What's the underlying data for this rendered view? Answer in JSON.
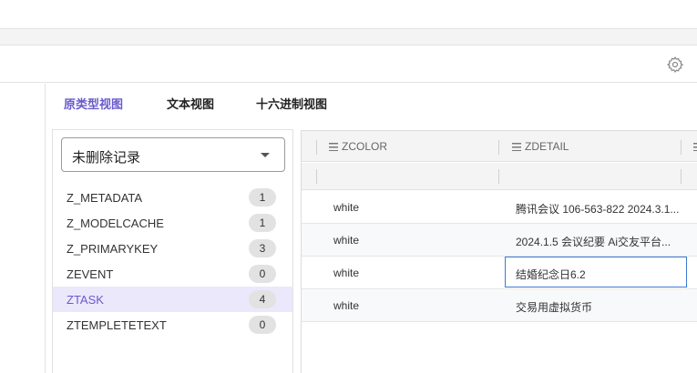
{
  "views": {
    "tabs": [
      {
        "label": "原类型视图",
        "active": true
      },
      {
        "label": "文本视图",
        "active": false
      },
      {
        "label": "十六进制视图",
        "active": false
      }
    ]
  },
  "filter": {
    "selected": "未删除记录"
  },
  "tables": [
    {
      "name": "Z_METADATA",
      "count": "1"
    },
    {
      "name": "Z_MODELCACHE",
      "count": "1"
    },
    {
      "name": "Z_PRIMARYKEY",
      "count": "3"
    },
    {
      "name": "ZEVENT",
      "count": "0"
    },
    {
      "name": "ZTASK",
      "count": "4",
      "active": true
    },
    {
      "name": "ZTEMPLETETEXT",
      "count": "0"
    }
  ],
  "grid": {
    "columns": [
      "ZCOLOR",
      "ZDETAIL"
    ],
    "rows": [
      [
        "white",
        "腾讯会议 106-563-822 2024.3.1..."
      ],
      [
        "white",
        "2024.1.5 会议纪要 Ai交友平台..."
      ],
      [
        "white",
        "结婚纪念日6.2"
      ],
      [
        "white",
        "交易用虚拟货币"
      ]
    ]
  },
  "colors": {
    "accent": "#6a5acd",
    "selected_bg": "#ece8fb",
    "focus_border": "#3a7bd5"
  },
  "icons": {
    "settings": "gear-icon",
    "column": "list-icon",
    "dropdown": "caret-down-icon"
  }
}
